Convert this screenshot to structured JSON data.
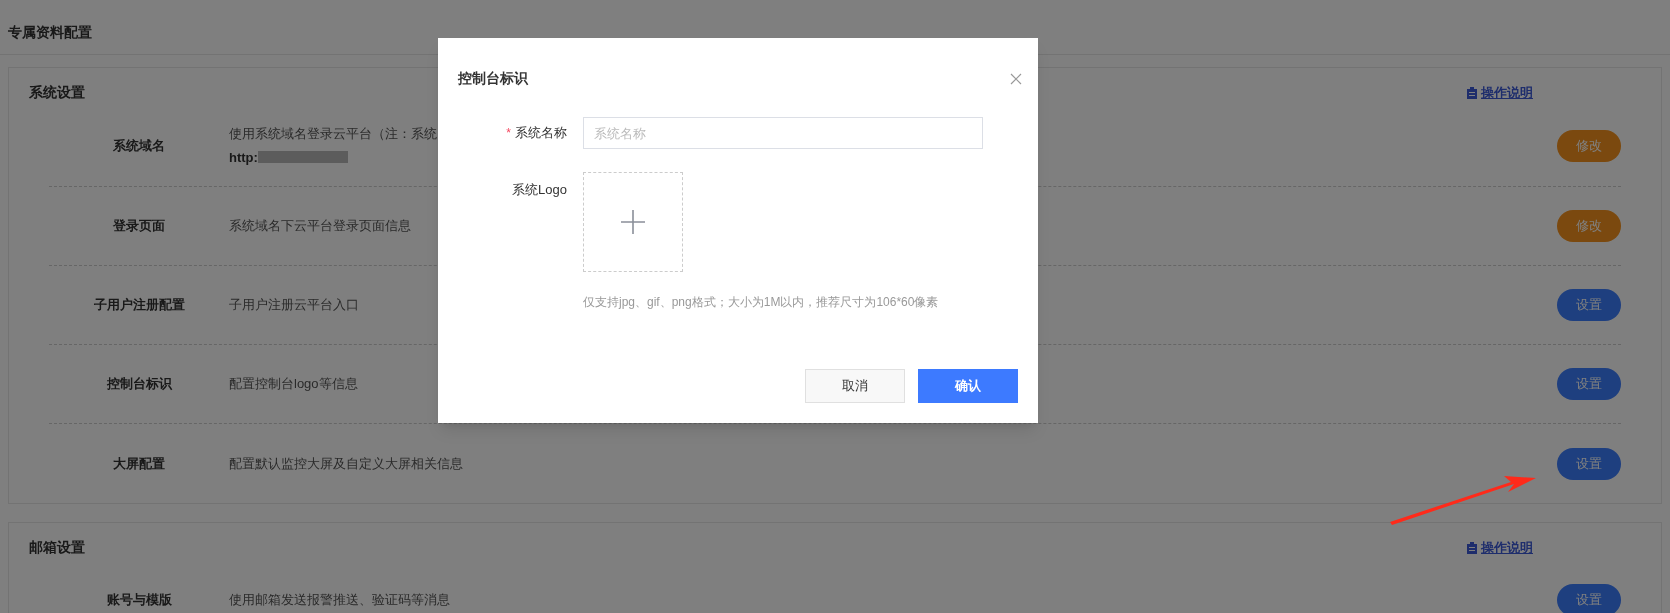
{
  "page_title": "专属资料配置",
  "sections": [
    {
      "title": "系统设置",
      "help_link": "操作说明",
      "rows": [
        {
          "label": "系统域名",
          "description": "使用系统域名登录云平台（注：系统",
          "detail": "http:",
          "button": {
            "label": "修改",
            "kind": "edit"
          }
        },
        {
          "label": "登录页面",
          "description": "系统域名下云平台登录页面信息",
          "button": {
            "label": "修改",
            "kind": "edit"
          }
        },
        {
          "label": "子用户注册配置",
          "description": "子用户注册云平台入口",
          "button": {
            "label": "设置",
            "kind": "setup"
          }
        },
        {
          "label": "控制台标识",
          "description": "配置控制台logo等信息",
          "button": {
            "label": "设置",
            "kind": "setup"
          }
        },
        {
          "label": "大屏配置",
          "description": "配置默认监控大屏及自定义大屏相关信息",
          "button": {
            "label": "设置",
            "kind": "setup"
          }
        }
      ]
    },
    {
      "title": "邮箱设置",
      "help_link": "操作说明",
      "rows": [
        {
          "label": "账号与模版",
          "description": "使用邮箱发送报警推送、验证码等消息",
          "button": {
            "label": "设置",
            "kind": "setup"
          }
        }
      ]
    }
  ],
  "modal": {
    "title": "控制台标识",
    "name_label": "系统名称",
    "required_mark": "*",
    "name_placeholder": "系统名称",
    "logo_label": "系统Logo",
    "logo_hint": "仅支持jpg、gif、png格式；大小为1M以内，推荐尺寸为106*60像素",
    "cancel": "取消",
    "confirm": "确认"
  }
}
